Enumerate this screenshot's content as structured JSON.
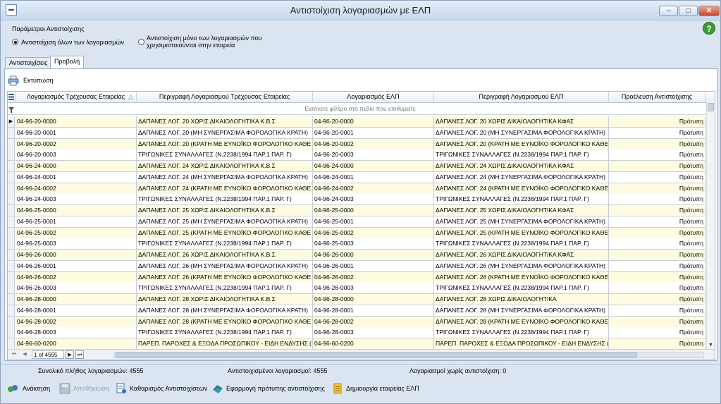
{
  "window": {
    "title": "Αντιστοίχιση λογαριασμών με ΕΛΠ",
    "minimize": "–",
    "maximize": "□",
    "close": "✕"
  },
  "params": {
    "title": "Παράμετροι Αντιστοίχισης",
    "option_all": "Αντιστοίχιση όλων των λογαριασμών",
    "option_used_line1": "Αντιστοίχιση μόνο των λογαριασμών που",
    "option_used_line2": "χρησιμοποιούνται στην εταιρεία"
  },
  "help": "?",
  "tabs": [
    {
      "label": "Αντιστοιχίσεις"
    },
    {
      "label": "Προβολή"
    }
  ],
  "toolbar": {
    "print_label": "Εκτύπωση"
  },
  "grid": {
    "columns": [
      "Λογαριασμός Τρέχουσας Εταιρείας",
      "Περιγραφή Λογαριασμού Τρέχουσας Εταιρείας",
      "Λογαριασμός ΕΛΠ",
      "Περιγραφή Λογαριασμού ΕΛΠ",
      "Προέλευση Αντιστοίχισης"
    ],
    "filter_placeholder": "Εισάγετε φίλτρο στο πεδίο που επιθυμείτε",
    "rows": [
      [
        "04-96-20-0000",
        "ΔΑΠΑΝΕΣ ΛΟΓ. 20 ΧΩΡΙΣ ΔΙΚΑΙΟΛΟΓΗΤΙΚΑ Κ.Β.Σ",
        "04-96-20-0000",
        "ΔΑΠΑΝΕΣ ΛΟΓ. 20 ΧΩΡΙΣ ΔΙΚΑΙΟΛΟΓΗΤΙΚΑ ΚΦΑΣ",
        "Πρότυπη"
      ],
      [
        "04-96-20-0001",
        "ΔΑΠΑΝΕΣ ΛΟΓ. 20 (ΜΗ ΣΥΝΕΡΓΑΣΙΜΑ ΦΟΡΟΛΟΓΙΚΑ ΚΡΑΤΗ)",
        "04-96-20-0001",
        "ΔΑΠΑΝΕΣ ΛΟΓ. 20 (ΜΗ ΣΥΝΕΡΓΑΣΙΜΑ ΦΟΡΟΛΟΓΙΚΑ ΚΡΑΤΗ)",
        "Πρότυπη"
      ],
      [
        "04-96-20-0002",
        "ΔΑΠΑΝΕΣ ΛΟΓ. 20 (ΚΡΑΤΗ ΜΕ ΕΥΝΟΪΚΟ ΦΟΡΟΛΟΓΙΚΟ ΚΑΘΕ",
        "04-96-20-0002",
        "ΔΑΠΑΝΕΣ ΛΟΓ. 20 (ΚΡΑΤΗ ΜΕ ΕΥΝΟΪΚΟ ΦΟΡΟΛΟΓΙΚΟ ΚΑΘΕ",
        "Πρότυπη"
      ],
      [
        "04-96-20-0003",
        "ΤΡΙΓΩΝΙΚΕΣ ΣΥΝΑΛΛΑΓΕΣ (Ν.2238/1994 ΠΑΡ.1 ΠΑΡ. Γ)",
        "04-96-20-0003",
        "ΤΡΙΓΩΝΙΚΕΣ ΣΥΝΑΛΛΑΓΕΣ (Ν.2238/1994 ΠΑΡ.1 ΠΑΡ. Γ)",
        "Πρότυπη"
      ],
      [
        "04-96-24-0000",
        "ΔΑΠΑΝΕΣ ΛΟΓ. 24 ΧΩΡΙΣ ΔΙΚΑΙΟΛΟΓΗΤΙΚΑ Κ.Β.Σ",
        "04-96-24-0000",
        "ΔΑΠΑΝΕΣ ΛΟΓ. 24 ΧΩΡΙΣ ΔΙΚΑΙΟΛΟΓΗΤΙΚΑ ΚΦΑΣ",
        "Πρότυπη"
      ],
      [
        "04-96-24-0001",
        "ΔΑΠΑΝΕΣ ΛΟΓ. 24 (ΜΗ ΣΥΝΕΡΓΑΣΙΜΑ ΦΟΡΟΛΟΓΙΚΑ ΚΡΑΤΗ)",
        "04-96-24-0001",
        "ΔΑΠΑΝΕΣ ΛΟΓ. 24 (ΜΗ ΣΥΝΕΡΓΑΣΙΜΑ ΦΟΡΟΛΟΓΙΚΑ ΚΡΑΤΗ)",
        "Πρότυπη"
      ],
      [
        "04-96-24-0002",
        "ΔΑΠΑΝΕΣ ΛΟΓ. 24 (ΚΡΑΤΗ ΜΕ ΕΥΝΟΪΚΟ ΦΟΡΟΛΟΓΙΚΟ ΚΑΘΕ",
        "04-96-24-0002",
        "ΔΑΠΑΝΕΣ ΛΟΓ. 24 (ΚΡΑΤΗ ΜΕ ΕΥΝΟΪΚΟ ΦΟΡΟΛΟΓΙΚΟ ΚΑΘΕ",
        "Πρότυπη"
      ],
      [
        "04-96-24-0003",
        "ΤΡΙΓΩΝΙΚΕΣ ΣΥΝΑΛΛΑΓΕΣ (Ν.2238/1994 ΠΑΡ.1 ΠΑΡ. Γ)",
        "04-96-24-0003",
        "ΤΡΙΓΩΝΙΚΕΣ ΣΥΝΑΛΛΑΓΕΣ (Ν.2238/1994 ΠΑΡ.1 ΠΑΡ. Γ)",
        "Πρότυπη"
      ],
      [
        "04-96-25-0000",
        "ΔΑΠΑΝΕΣ ΛΟΓ. 25 ΧΩΡΙΣ ΔΙΚΑΙΟΛΟΓΗΤΙΚΑ Κ.Β.Σ",
        "04-96-25-0000",
        "ΔΑΠΑΝΕΣ ΛΟΓ. 25 ΧΩΡΙΣ ΔΙΚΑΙΟΛΟΓΗΤΙΚΑ ΚΦΑΣ",
        "Πρότυπη"
      ],
      [
        "04-96-25-0001",
        "ΔΑΠΑΝΕΣ ΛΟΓ. 25 (ΜΗ ΣΥΝΕΡΓΑΣΙΜΑ ΦΟΡΟΛΟΓΙΚΑ ΚΡΑΤΗ)",
        "04-96-25-0001",
        "ΔΑΠΑΝΕΣ ΛΟΓ. 25 (ΜΗ ΣΥΝΕΡΓΑΣΙΜΑ ΦΟΡΟΛΟΓΙΚΑ ΚΡΑΤΗ)",
        "Πρότυπη"
      ],
      [
        "04-96-25-0002",
        "ΔΑΠΑΝΕΣ ΛΟΓ. 25 (ΚΡΑΤΗ ΜΕ ΕΥΝΟΪΚΟ ΦΟΡΟΛΟΓΙΚΟ ΚΑΘΕ",
        "04-96-25-0002",
        "ΔΑΠΑΝΕΣ ΛΟΓ. 25 (ΚΡΑΤΗ ΜΕ ΕΥΝΟΪΚΟ ΦΟΡΟΛΟΓΙΚΟ ΚΑΘΕ",
        "Πρότυπη"
      ],
      [
        "04-96-25-0003",
        "ΤΡΙΓΩΝΙΚΕΣ ΣΥΝΑΛΛΑΓΕΣ (Ν.2238/1994 ΠΑΡ.1 ΠΑΡ. Γ)",
        "04-96-25-0003",
        "ΤΡΙΓΩΝΙΚΕΣ ΣΥΝΑΛΛΑΓΕΣ (Ν.2238/1994 ΠΑΡ.1 ΠΑΡ. Γ)",
        "Πρότυπη"
      ],
      [
        "04-96-26-0000",
        "ΔΑΠΑΝΕΣ ΛΟΓ. 26 ΧΩΡΙΣ ΔΙΚΑΙΟΛΟΓΗΤΙΚΑ Κ.Β.Σ",
        "04-96-26-0000",
        "ΔΑΠΑΝΕΣ ΛΟΓ. 26 ΧΩΡΙΣ ΔΙΚΑΙΟΛΟΓΗΤΙΚΑ ΚΦΑΣ",
        "Πρότυπη"
      ],
      [
        "04-96-26-0001",
        "ΔΑΠΑΝΕΣ ΛΟΓ. 26 (ΜΗ ΣΥΝΕΡΓΑΣΙΜΑ ΦΟΡΟΛΟΓΙΚΑ ΚΡΑΤΗ)",
        "04-96-26-0001",
        "ΔΑΠΑΝΕΣ ΛΟΓ. 26 (ΜΗ ΣΥΝΕΡΓΑΣΙΜΑ ΦΟΡΟΛΟΓΙΚΑ ΚΡΑΤΗ)",
        "Πρότυπη"
      ],
      [
        "04-96-26-0002",
        "ΔΑΠΑΝΕΣ ΛΟΓ. 26 (ΚΡΑΤΗ ΜΕ ΕΥΝΟΪΚΟ ΦΟΡΟΛΟΓΙΚΟ ΚΑΘΕ",
        "04-96-26-0002",
        "ΔΑΠΑΝΕΣ ΛΟΓ. 26 (ΚΡΑΤΗ ΜΕ ΕΥΝΟΪΚΟ ΦΟΡΟΛΟΓΙΚΟ ΚΑΘΕ",
        "Πρότυπη"
      ],
      [
        "04-96-26-0003",
        "ΤΡΙΓΩΝΙΚΕΣ ΣΥΝΑΛΛΑΓΕΣ (Ν.2238/1994 ΠΑΡ.1 ΠΑΡ. Γ)",
        "04-96-26-0003",
        "ΤΡΙΓΩΝΙΚΕΣ ΣΥΝΑΛΛΑΓΕΣ (Ν.2238/1994 ΠΑΡ.1 ΠΑΡ. Γ)",
        "Πρότυπη"
      ],
      [
        "04-96-28-0000",
        "ΔΑΠΑΝΕΣ ΛΟΓ. 28 ΧΩΡΙΣ ΔΙΚΑΙΟΛΟΓΗΤΙΚΑ Κ.Β.Σ",
        "04-96-28-0000",
        "ΔΑΠΑΝΕΣ ΛΟΓ. 28 ΧΩΡΙΣ ΔΙΚΑΙΟΛΟΓΗΤΙΚΑ",
        "Πρότυπη"
      ],
      [
        "04-96-28-0001",
        "ΔΑΠΑΝΕΣ ΛΟΓ. 28 (ΜΗ ΣΥΝΕΡΓΑΣΙΜΑ ΦΟΡΟΛΟΓΙΚΑ ΚΡΑΤΗ)",
        "04-96-28-0001",
        "ΔΑΠΑΝΕΣ ΛΟΓ. 28 (ΜΗ ΣΥΝΕΡΓΑΣΙΜΑ ΦΟΡΟΛΟΓΙΚΑ ΚΡΑΤΗ)",
        "Πρότυπη"
      ],
      [
        "04-96-28-0002",
        "ΔΑΠΑΝΕΣ ΛΟΓ. 28 (ΚΡΑΤΗ ΜΕ ΕΥΝΟΪΚΟ ΦΟΡΟΛΟΓΙΚΟ ΚΑΘΕ",
        "04-96-28-0002",
        "ΔΑΠΑΝΕΣ ΛΟΓ. 28 (ΚΡΑΤΗ ΜΕ ΕΥΝΟΪΚΟ ΦΟΡΟΛΟΓΙΚΟ ΚΑΘΕ",
        "Πρότυπη"
      ],
      [
        "04-96-28-0003",
        "ΤΡΙΓΩΝΙΚΕΣ ΣΥΝΑΛΛΑΓΕΣ (Ν.2238/1994 ΠΑΡ.1 ΠΑΡ. Γ)",
        "04-96-28-0003",
        "ΤΡΙΓΩΝΙΚΕΣ ΣΥΝΑΛΛΑΓΕΣ (Ν.2238/1994 ΠΑΡ.1 ΠΑΡ. Γ)",
        "Πρότυπη"
      ],
      [
        "04-96-60-0200",
        "ΠΑΡΕΠ. ΠΑΡΟΧΕΣ & ΕΞΟΔΑ ΠΡΟΣΩΠΙΚΟΥ - ΕΙΔΗ ΕΝΔΥΣΗΣ (",
        "04-96-60-0200",
        "ΠΑΡΕΠ. ΠΑΡΟΧΕΣ & ΕΞΟΔΑ ΠΡΟΣΩΠΙΚΟΥ - ΕΙΔΗ ΕΝΔΥΣΗΣ (",
        "Πρότυπη"
      ]
    ],
    "pager_value": "1 of 4555"
  },
  "status": {
    "total": "Συνολικό πλήθος λογαριασμών: 4555",
    "matched": "Αντιστοιχισμένοι λογαριασμοί: 4555",
    "unmatched": "Λογαριασμοί χωρίς αντιστοίχιση: 0"
  },
  "buttons": {
    "refresh": "Ανάκτηση",
    "save": "Αποθήκευση",
    "clear": "Καθαρισμός Αντιστοιχίσεων",
    "apply": "Εφαρμογή πρότυπης αντιστοίχισης",
    "create": "Δημιουργία εταιρείας ΕΛΠ"
  }
}
